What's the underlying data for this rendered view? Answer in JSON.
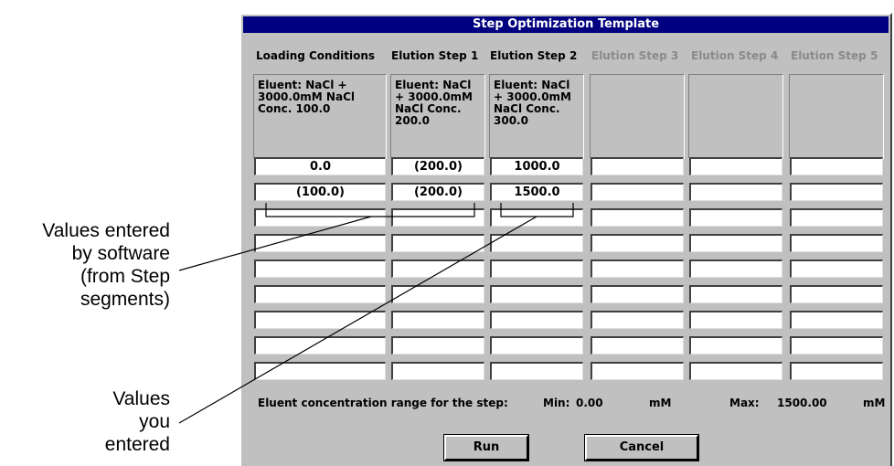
{
  "annotations": {
    "software_entered": "Values entered\nby software\n(from Step\nsegments)",
    "user_entered": "Values\nyou\nentered"
  },
  "window": {
    "title": "Step Optimization Template",
    "columns": [
      {
        "header": "Loading Conditions",
        "enabled": true,
        "info": "Eluent: NaCl +\n3000.0mM NaCl\nConc. 100.0"
      },
      {
        "header": "Elution Step 1",
        "enabled": true,
        "info": "Eluent: NaCl\n+ 3000.0mM\nNaCl Conc.\n200.0"
      },
      {
        "header": "Elution Step 2",
        "enabled": true,
        "info": "Eluent: NaCl\n+ 3000.0mM\nNaCl Conc.\n300.0"
      },
      {
        "header": "Elution Step 3",
        "enabled": false,
        "info": ""
      },
      {
        "header": "Elution Step 4",
        "enabled": false,
        "info": ""
      },
      {
        "header": "Elution Step 5",
        "enabled": false,
        "info": ""
      }
    ],
    "grid": [
      [
        "0.0",
        "(200.0)",
        "1000.0",
        "",
        "",
        ""
      ],
      [
        "(100.0)",
        "(200.0)",
        "1500.0",
        "",
        "",
        ""
      ],
      [
        "",
        "",
        "",
        "",
        "",
        ""
      ],
      [
        "",
        "",
        "",
        "",
        "",
        ""
      ],
      [
        "",
        "",
        "",
        "",
        "",
        ""
      ],
      [
        "",
        "",
        "",
        "",
        "",
        ""
      ],
      [
        "",
        "",
        "",
        "",
        "",
        ""
      ],
      [
        "",
        "",
        "",
        "",
        "",
        ""
      ],
      [
        "",
        "",
        "",
        "",
        "",
        ""
      ]
    ],
    "footer": {
      "range_label": "Eluent concentration range for the step:",
      "min_label": "Min:",
      "min_value": "0.00",
      "min_unit": "mM",
      "max_label": "Max:",
      "max_value": "1500.00",
      "max_unit": "mM"
    },
    "buttons": {
      "run": "Run",
      "cancel": "Cancel"
    }
  }
}
